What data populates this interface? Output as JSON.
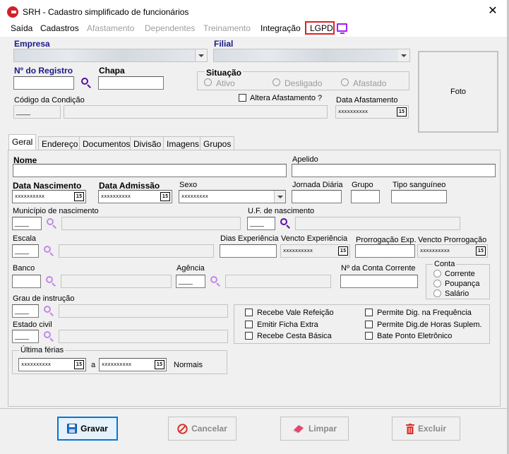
{
  "window": {
    "title": "SRH - Cadastro simplificado de funcionários",
    "close": "✕"
  },
  "menu": {
    "saida": "Saída",
    "cadastros": "Cadastros",
    "afastamento": "Afastamento",
    "dependentes": "Dependentes",
    "treinamento": "Treinamento",
    "integracao": "Integração",
    "lgpd": "LGPD"
  },
  "header": {
    "empresa_label": "Empresa",
    "filial_label": "Filial",
    "registro_label": "Nº do Registro",
    "chapa_label": "Chapa",
    "situacao_label": "Situação",
    "situacao_options": [
      "Ativo",
      "Desligado",
      "Afastado"
    ],
    "condicao_label": "Código da Condição",
    "altera_afastamento_label": "Altera Afastamento ?",
    "data_afastamento_label": "Data Afastamento",
    "date_placeholder": "xxxxxxxxxx",
    "foto_label": "Foto",
    "cal_glyph": "15"
  },
  "tabs": [
    "Geral",
    "Endereço",
    "Documentos",
    "Divisão",
    "Imagens",
    "Grupos"
  ],
  "geral": {
    "nome_label": "Nome",
    "apelido_label": "Apelido",
    "data_nascimento_label": "Data Nascimento",
    "data_admissao_label": "Data Admissão",
    "sexo_label": "Sexo",
    "sexo_value": "xxxxxxxxx",
    "jornada_label": "Jornada Diária",
    "grupo_label": "Grupo",
    "tipo_sanguineo_label": "Tipo sanguíneo",
    "municipio_label": "Município de nascimento",
    "uf_label": "U.F. de nascimento",
    "escala_label": "Escala",
    "dias_experiencia_label": "Dias Experiência",
    "vencto_experiencia_label": "Vencto Experiência",
    "prorrogacao_label": "Prorrogação Exp.",
    "vencto_prorrogacao_label": "Vencto Prorrogação",
    "banco_label": "Banco",
    "agencia_label": "Agência",
    "conta_label": "Nº da Conta Corrente",
    "conta_group_label": "Conta",
    "conta_options": [
      "Corrente",
      "Poupança",
      "Salário"
    ],
    "grau_instrucao_label": "Grau de instrução",
    "estado_civil_label": "Estado civil",
    "checkboxes_left": [
      "Recebe Vale Refeição",
      "Emitir Ficha Extra",
      "Recebe Cesta Básica"
    ],
    "checkboxes_right": [
      "Permite Dig. na Frequência",
      "Permite Dig.de Horas Suplem.",
      "Bate Ponto Eletrônico"
    ],
    "ultima_ferias_label": "Última férias",
    "a_label": "a",
    "normais_label": "Normais",
    "short_value": "____"
  },
  "buttons": {
    "gravar": "Gravar",
    "cancelar": "Cancelar",
    "limpar": "Limpar",
    "excluir": "Excluir"
  },
  "colors": {
    "accent": "#0078d7",
    "lookup": "#9b30d0",
    "highlight": "#e02020",
    "app_icon": "#d32027"
  }
}
